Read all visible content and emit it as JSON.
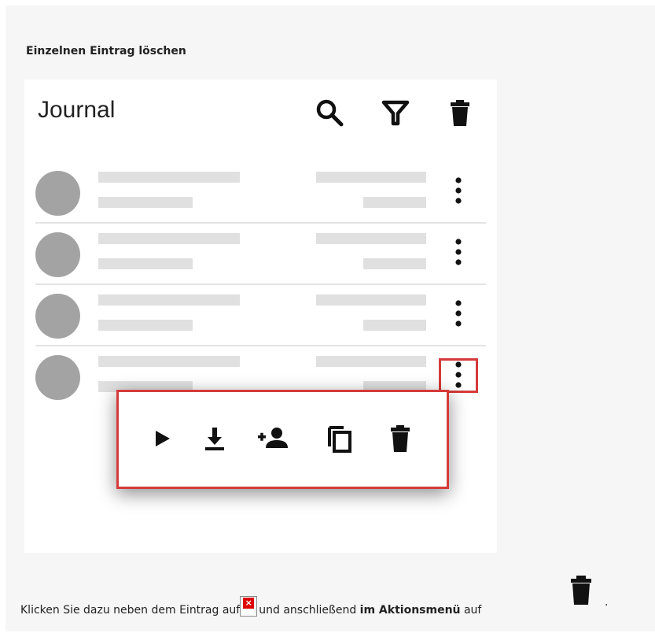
{
  "heading": "Einzelnen Eintrag löschen",
  "app": {
    "title": "Journal",
    "header_icons": [
      "search-icon",
      "filter-icon",
      "trash-icon"
    ]
  },
  "list": {
    "row_count": 4,
    "placeholder_color": "#e0e0e0",
    "avatar_color": "#a3a3a3"
  },
  "action_menu": {
    "icons": [
      "play-icon",
      "download-icon",
      "add-user-icon",
      "copy-icon",
      "delete-icon"
    ]
  },
  "highlight_color": "#d63a3a",
  "instruction": {
    "part1": "Klicken Sie dazu neben dem Eintrag auf",
    "broken_image_glyph": "×",
    "part2": "und anschließend ",
    "bold": "im Aktionsmenü",
    "part3": " auf",
    "end": "."
  }
}
